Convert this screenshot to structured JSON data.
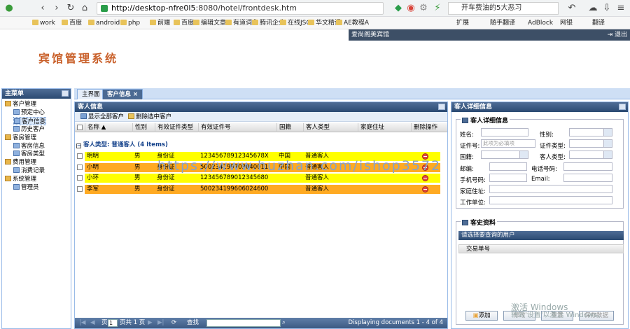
{
  "browser": {
    "url_host": "http://desktop-nfre0l5",
    "url_path": ":8080/hotel/frontdesk.htm",
    "search_text": "开车费油的5大恶习",
    "bookmarks": [
      "work",
      "百度",
      "android",
      "php",
      "前端",
      "百度",
      "编辑文章",
      "有道词典",
      "腾讯企业",
      "在线JSO",
      "华文精课",
      "AE教程A"
    ],
    "right_bookmarks": [
      "扩展",
      "随手翻译",
      "AdBlock",
      "网银",
      "翻译"
    ]
  },
  "header": {
    "user_text": "爱尚阁美宾馆",
    "logout_label": "退出",
    "app_title": "宾馆管理系统"
  },
  "menu": {
    "title": "主菜单",
    "items": [
      {
        "label": "客户管理"
      },
      {
        "label": "预定中心"
      },
      {
        "label": "客户信息"
      },
      {
        "label": "历史客户"
      },
      {
        "label": "客房管理"
      },
      {
        "label": "客房信息"
      },
      {
        "label": "客房类型"
      },
      {
        "label": "费用管理"
      },
      {
        "label": "消费记录"
      },
      {
        "label": "系统管理"
      },
      {
        "label": "管理员"
      }
    ]
  },
  "tabs": [
    {
      "label": "主界面"
    },
    {
      "label": "客户信息"
    }
  ],
  "guest_panel": {
    "title": "客人信息",
    "show_all_label": "显示全部客户",
    "delete_selected_label": "删除选中客户",
    "columns": [
      "名称 ▲",
      "性别",
      "有效证件类型",
      "有效证件号",
      "国籍",
      "客人类型",
      "家庭住址",
      "删除操作"
    ],
    "group_label": "客人类型: 普通客人 (4 Items)",
    "rows": [
      {
        "name": "明明",
        "gender": "男",
        "id_type": "身份证",
        "id_no": "12345678912345678X",
        "nation": "中国",
        "guest_type": "普通客人",
        "address": "",
        "color": "#ffff00"
      },
      {
        "name": "小明",
        "gender": "男",
        "id_type": "身份证",
        "id_no": "500234199703040011",
        "nation": "中国",
        "guest_type": "普通客人",
        "address": "",
        "color": "#ffaa22"
      },
      {
        "name": "小环",
        "gender": "男",
        "id_type": "身份证",
        "id_no": "123456789012345680",
        "nation": "",
        "guest_type": "普通客人",
        "address": "",
        "color": "#ffff00"
      },
      {
        "name": "李军",
        "gender": "男",
        "id_type": "身份证",
        "id_no": "500234199606024600",
        "nation": "",
        "guest_type": "普通客人",
        "address": "",
        "color": "#ffaa22"
      }
    ],
    "paging": {
      "page_label": "页",
      "page_value": "1",
      "page_total": "页共 1 页",
      "search_label": "查找",
      "display_text": "Displaying documents 1 - 4 of 4"
    }
  },
  "detail_panel": {
    "title": "客人详细信息",
    "fieldset_title": "客人详细信息",
    "fields": {
      "name": "姓名:",
      "gender": "性别:",
      "id_no": "证件号:",
      "id_no_placeholder": "此项为必填项",
      "id_type": "证件类型:",
      "nation": "国籍:",
      "guest_type": "客人类型:",
      "company": "邮编:",
      "phone": "电话号码:",
      "mobile": "手机号码:",
      "email": "Email:",
      "address": "家庭住址:",
      "work": "工作单位:"
    },
    "history_title": "客史资料",
    "history_hint": "请选择要查询的用户",
    "history_column": "交易单号",
    "buttons": [
      "添加",
      "修改",
      "重置",
      "保存数据"
    ]
  },
  "watermark": "https://www.huzhan.com/ishop3572",
  "windows_text": [
    "激活 Windows",
    "转到'设置'以激活 Windows。"
  ]
}
